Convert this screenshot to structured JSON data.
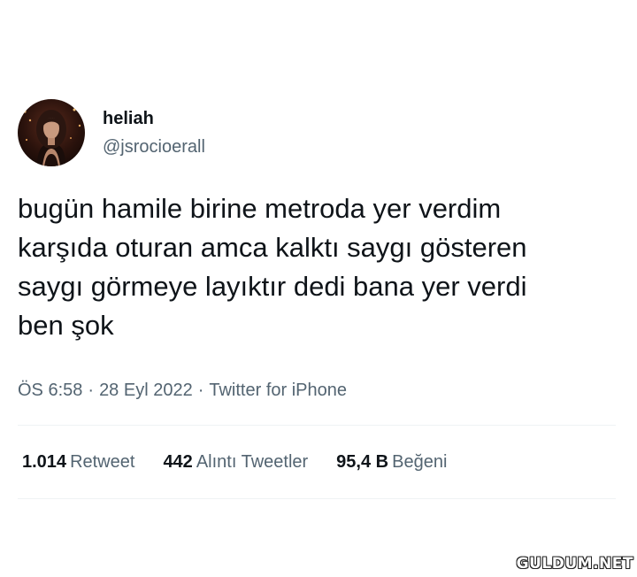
{
  "tweet": {
    "author": {
      "display_name": "heliah",
      "handle": "@jsrocioerall",
      "avatar_icon": "profile-photo-avatar"
    },
    "text": "bugün hamile birine metroda yer verdim\nkarşıda oturan amca kalktı saygı gösteren\nsaygı görmeye layıktır dedi bana yer verdi\nben şok",
    "meta": {
      "time": "ÖS 6:58",
      "separator": "·",
      "date": "28 Eyl 2022",
      "source": "Twitter for iPhone"
    },
    "stats": [
      {
        "value": "1.014",
        "label": "Retweet"
      },
      {
        "value": "442",
        "label": "Alıntı Tweetler"
      },
      {
        "value": "95,4 B",
        "label": "Beğeni"
      }
    ]
  },
  "watermark": "GULDUM.NET",
  "colors": {
    "text_primary": "#0f1419",
    "text_secondary": "#536471",
    "divider": "#eff3f4",
    "background": "#ffffff"
  }
}
